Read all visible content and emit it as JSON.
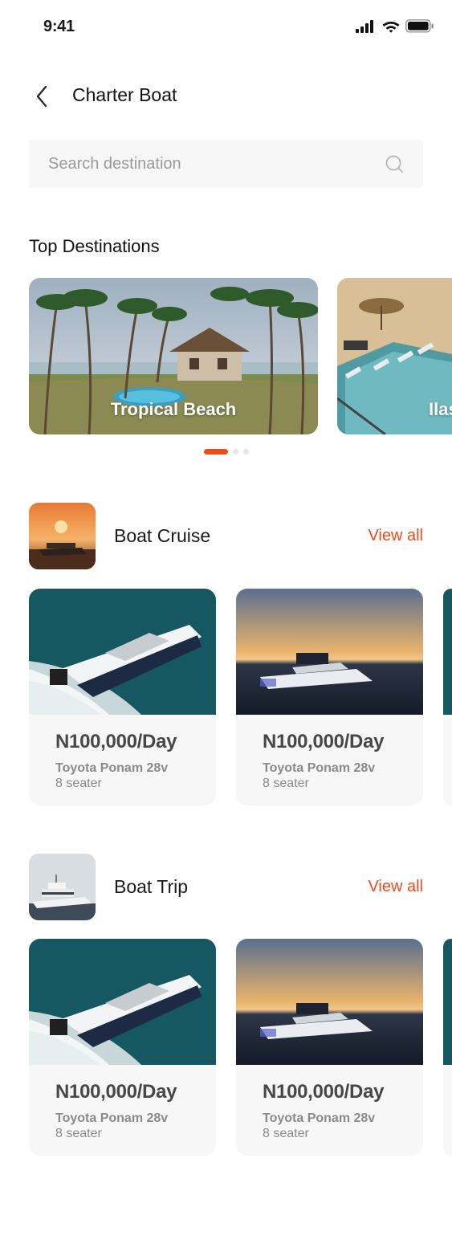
{
  "status": {
    "time": "9:41"
  },
  "header": {
    "title": "Charter Boat"
  },
  "search": {
    "placeholder": "Search destination"
  },
  "destinations": {
    "title": "Top Destinations",
    "items": [
      {
        "label": "Tropical Beach"
      },
      {
        "label": "Ilas"
      }
    ],
    "carousel_page": 1,
    "carousel_total": 3
  },
  "categories": [
    {
      "title": "Boat Cruise",
      "view_all": "View all",
      "boats": [
        {
          "price": "N100,000/Day",
          "model": "Toyota Ponam 28v",
          "seats": "8 seater"
        },
        {
          "price": "N100,000/Day",
          "model": "Toyota Ponam 28v",
          "seats": "8 seater"
        }
      ]
    },
    {
      "title": "Boat Trip",
      "view_all": "View all",
      "boats": [
        {
          "price": "N100,000/Day",
          "model": "Toyota Ponam 28v",
          "seats": "8 seater"
        },
        {
          "price": "N100,000/Day",
          "model": "Toyota Ponam 28v",
          "seats": "8 seater"
        }
      ]
    }
  ],
  "colors": {
    "accent": "#f04a1c",
    "card_bg": "#f7f7f7",
    "search_bg": "#f7f7f7"
  }
}
